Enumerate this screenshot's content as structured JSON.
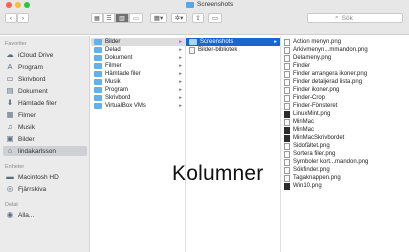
{
  "window": {
    "title": "Screenshots"
  },
  "traffic_lights": [
    "#fe5f57",
    "#febc2e",
    "#28c840"
  ],
  "toolbar": {
    "back_icon": "chevron-left",
    "forward_icon": "chevron-right",
    "view_icons": [
      "icon-view",
      "list-view",
      "column-view",
      "gallery-view"
    ],
    "group_icon": "group-menu",
    "action_icon": "gear",
    "share_icon": "share",
    "tag_icon": "tag",
    "search_placeholder": "Sök"
  },
  "sidebar": {
    "favorites_header": "Favoriter",
    "favorites": [
      {
        "label": "iCloud Drive",
        "icon": "☁"
      },
      {
        "label": "Program",
        "icon": "A"
      },
      {
        "label": "Skrivbord",
        "icon": "▭"
      },
      {
        "label": "Dokument",
        "icon": "▤"
      },
      {
        "label": "Hämtade filer",
        "icon": "⬇"
      },
      {
        "label": "Filmer",
        "icon": "▦"
      },
      {
        "label": "Musik",
        "icon": "♫"
      },
      {
        "label": "Bilder",
        "icon": "▣"
      },
      {
        "label": "lindakarlsson",
        "icon": "⌂"
      }
    ],
    "devices_header": "Enheter",
    "devices": [
      {
        "label": "Macintosh HD",
        "icon": "▬"
      },
      {
        "label": "Fjärrskiva",
        "icon": "◎"
      }
    ],
    "shared_header": "Delat",
    "shared": [
      {
        "label": "Alla...",
        "icon": "◉"
      }
    ]
  },
  "column1": [
    "Bilder",
    "Delad",
    "Dokument",
    "Filmer",
    "Hämtade filer",
    "Musik",
    "Program",
    "Skrivbord",
    "VirtualBox VMs"
  ],
  "column2": [
    "Screenshots",
    "Bilder-bibliotek"
  ],
  "column3": [
    "Action menyn.png",
    "Arkivmenyn...mmandon.png",
    "Delameny.png",
    "Finder",
    "Finder arrangera ikoner.png",
    "Finder detaljerad lista.png",
    "Finder ikoner.png",
    "Finder-Crop",
    "Finder-Fönsteret",
    "LinuxMint.png",
    "MinMac",
    "MinMac",
    "MinMacSkrivbordet",
    "Sidofältet.png",
    "Sortera filer.png",
    "Symboler kort...mandon.png",
    "Sökfinder.png",
    "Tagaknappen.png",
    "Win10.png"
  ],
  "overlay_text": "Kolumner"
}
